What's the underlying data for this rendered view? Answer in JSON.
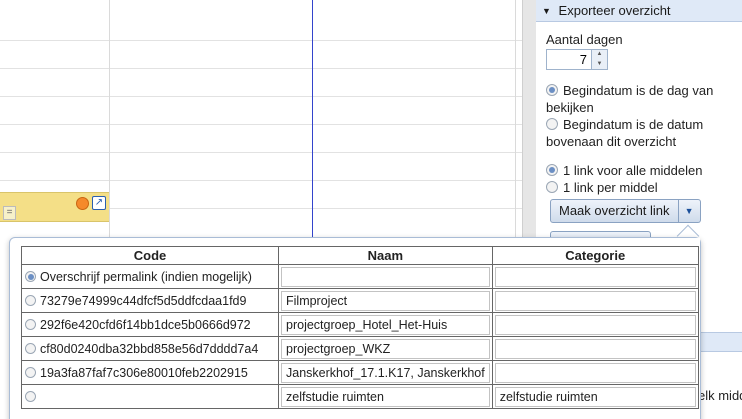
{
  "panel": {
    "title": "Exporteer overzicht",
    "days_label": "Aantal dagen",
    "days_value": "7",
    "start_options": [
      {
        "label": "Begindatum is de dag van bekijken",
        "selected": true
      },
      {
        "label": "Begindatum is de datum bovenaan dit overzicht",
        "selected": false
      }
    ],
    "link_options": [
      {
        "label": "1 link voor alle middelen",
        "selected": true
      },
      {
        "label": "1 link per middel",
        "selected": false
      }
    ],
    "make_button": "Maak overzicht link",
    "clipped_text": "elk midd"
  },
  "table": {
    "headers": {
      "code": "Code",
      "name": "Naam",
      "category": "Categorie"
    },
    "rows": [
      {
        "code": "Overschrijf permalink (indien mogelijk)",
        "name": "",
        "category": "",
        "selected": true
      },
      {
        "code": "73279e74999c44dfcf5d5ddfcdaa1fd9",
        "name": "Filmproject",
        "category": "",
        "selected": false
      },
      {
        "code": "292f6e420cfd6f14bb1dce5b0666d972",
        "name": "projectgroep_Hotel_Het-Huis",
        "category": "",
        "selected": false
      },
      {
        "code": "cf80d0240dba32bbd858e56d7dddd7a4",
        "name": "projectgroep_WKZ",
        "category": "",
        "selected": false
      },
      {
        "code": "19a3fa87faf7c306e80010feb2202915",
        "name": "Janskerkhof_17.1.K17,  Janskerkhof",
        "category": "",
        "selected": false
      },
      {
        "code": "",
        "name": "zelfstudie ruimten",
        "category": "zelfstudie ruimten",
        "selected": false
      }
    ]
  },
  "colors": {
    "accent": "#6b8fc4",
    "event": "#f4df87",
    "now_line": "#3344cc",
    "panel_header": "#dfe9f7"
  },
  "icons": {
    "event_status": "orange-dot-icon",
    "event_popout": "popout-icon",
    "collapse": "triangle-down-icon",
    "dropdown": "chevron-down-icon"
  }
}
